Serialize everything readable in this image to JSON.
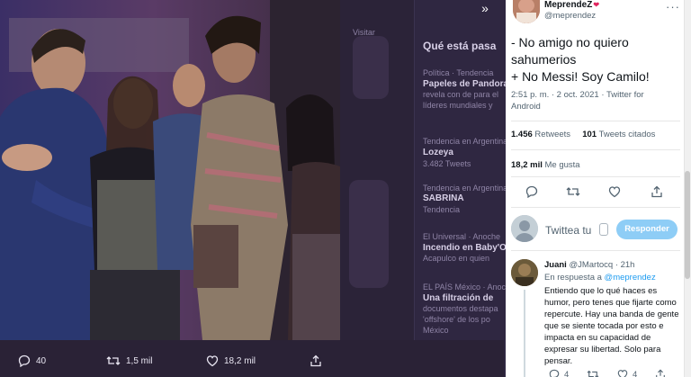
{
  "background": {
    "trends_title": "Qué está pasa",
    "visitar": "Visitar",
    "items": [
      {
        "meta": "Política · Tendencia",
        "title": "Papeles de Pandora",
        "line2": "revela con de para el",
        "line3": "líderes mundiales y"
      },
      {
        "meta": "Tendencia en Argentina",
        "title": "Lozeya",
        "line2": "3.482 Tweets",
        "line3": ""
      },
      {
        "meta": "Tendencia en Argentina",
        "title": "SABRINA",
        "line2": "Tendencia",
        "line3": ""
      },
      {
        "meta": "El Universal · Anoche",
        "title": "Incendio en Baby'O",
        "line2": "Acapulco en quien",
        "line3": ""
      },
      {
        "meta": "EL PAÍS México · Anoche",
        "title": "Una filtración de",
        "line2": "documentos destapa",
        "line3": "'offshore' de los po"
      },
      {
        "meta": "",
        "title": "México",
        "line2": "",
        "line3": ""
      }
    ]
  },
  "photo_actions": {
    "replies": "40",
    "retweets": "1,5 mil",
    "likes": "18,2 mil"
  },
  "nav": {
    "expand_icon": "»"
  },
  "tweet": {
    "author_name": "MeprendeZ",
    "author_badge": "❤",
    "author_handle": "@meprendez",
    "lines": [
      "- No amigo no quiero",
      "sahumerios",
      "+ No Messi! Soy Camilo!"
    ],
    "meta_line1": "2:51 p. m. · 2 oct. 2021 · Twitter for",
    "meta_line2": "Android",
    "retweets_num": "1.456",
    "retweets_label": "Retweets",
    "quotes_num": "101",
    "quotes_label": "Tweets citados",
    "likes_num": "18,2 mil",
    "likes_label": "Me gusta"
  },
  "compose": {
    "placeholder": "Twittea tu",
    "button": "Responder"
  },
  "reply": {
    "name": "Juani",
    "handle": "@JMartocq",
    "time": "· 21h",
    "in_reply_prefix": "En respuesta a",
    "in_reply_handle": "@meprendez",
    "lines": [
      "Entiendo que lo qué haces es",
      "humor, pero tenes que fijarte como",
      "repercute. Hay una banda de gente",
      "que se siente tocada por esto e",
      "impacta en su capacidad de",
      "expresar su libertad. Solo para",
      "pensar."
    ],
    "replies": "4",
    "retweets": "",
    "likes": "4"
  },
  "colors": {
    "accent": "#1d9bf0",
    "reply_button": "#8ecdf6",
    "overlay_bg": "#2a2236"
  }
}
